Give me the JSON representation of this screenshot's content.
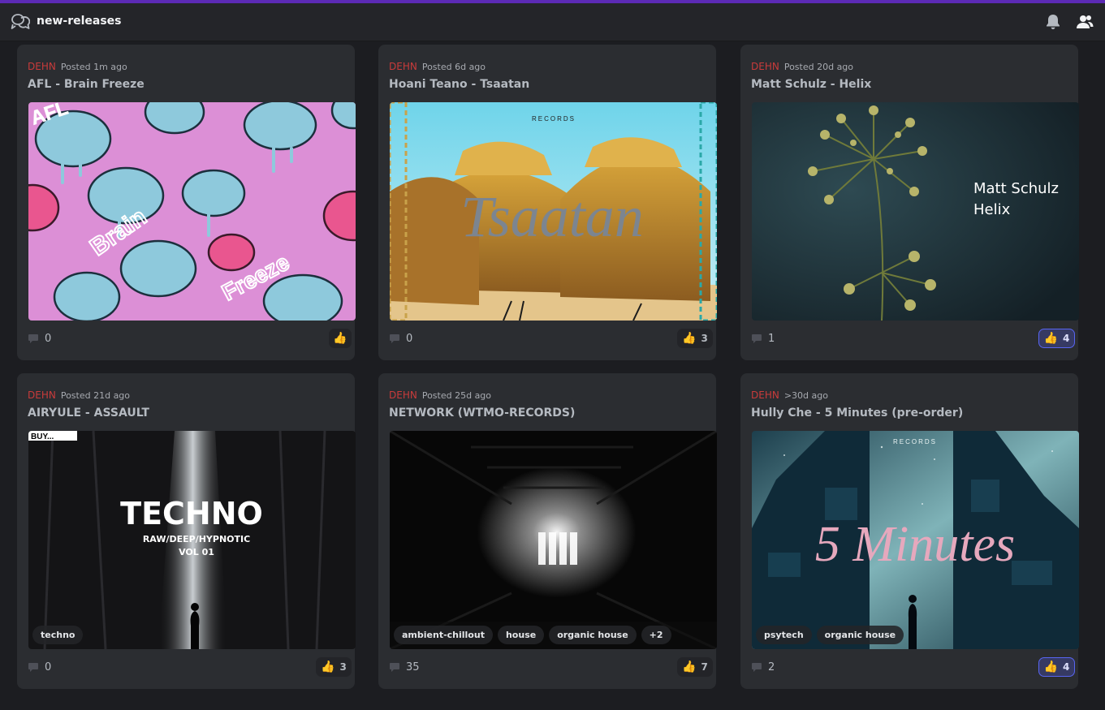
{
  "channel": {
    "name": "new-releases"
  },
  "icons": {
    "channel": "forum-channel-icon",
    "bell": "bell-icon",
    "members": "members-icon",
    "comment": "comment-icon",
    "reaction": "thumbs-up-icon"
  },
  "colors": {
    "accent": "#5865f2",
    "author": "#c93b3b",
    "topline": "#5c2ab5"
  },
  "posts": [
    {
      "author": "DEHN",
      "posted": "Posted 1m ago",
      "title": "AFL - Brain Freeze",
      "art_text": [
        "AFL",
        "Brain",
        "Freeze"
      ],
      "tags": [],
      "comments": "0",
      "reactions": "",
      "reaction_active": false
    },
    {
      "author": "DEHN",
      "posted": "Posted 6d ago",
      "title": "Hoani Teano - Tsaatan",
      "art_text": [
        "RECORDS",
        "Tsaatan"
      ],
      "tags": [],
      "comments": "0",
      "reactions": "3",
      "reaction_active": false
    },
    {
      "author": "DEHN",
      "posted": "Posted 20d ago",
      "title": "Matt Schulz - Helix",
      "art_text": [
        "Matt Schulz",
        "Helix"
      ],
      "tags": [],
      "comments": "1",
      "reactions": "4",
      "reaction_active": true
    },
    {
      "author": "DEHN",
      "posted": "Posted 21d ago",
      "title": "AIRYULE - ASSAULT",
      "art_text": [
        "BUY...",
        "TECHNO",
        "RAW/DEEP/HYPNOTIC",
        "VOL 01"
      ],
      "tags": [
        "techno"
      ],
      "comments": "0",
      "reactions": "3",
      "reaction_active": false
    },
    {
      "author": "DEHN",
      "posted": "Posted 25d ago",
      "title": "NETWORK (WTMO-RECORDS)",
      "art_text": [],
      "tags": [
        "ambient-chillout",
        "house",
        "organic house",
        "+2"
      ],
      "comments": "35",
      "reactions": "7",
      "reaction_active": false
    },
    {
      "author": "DEHN",
      "posted": ">30d ago",
      "title": "Hully Che - 5 Minutes (pre-order)",
      "art_text": [
        "RECORDS",
        "5 Minutes"
      ],
      "tags": [
        "psytech",
        "organic house"
      ],
      "comments": "2",
      "reactions": "4",
      "reaction_active": true
    }
  ]
}
